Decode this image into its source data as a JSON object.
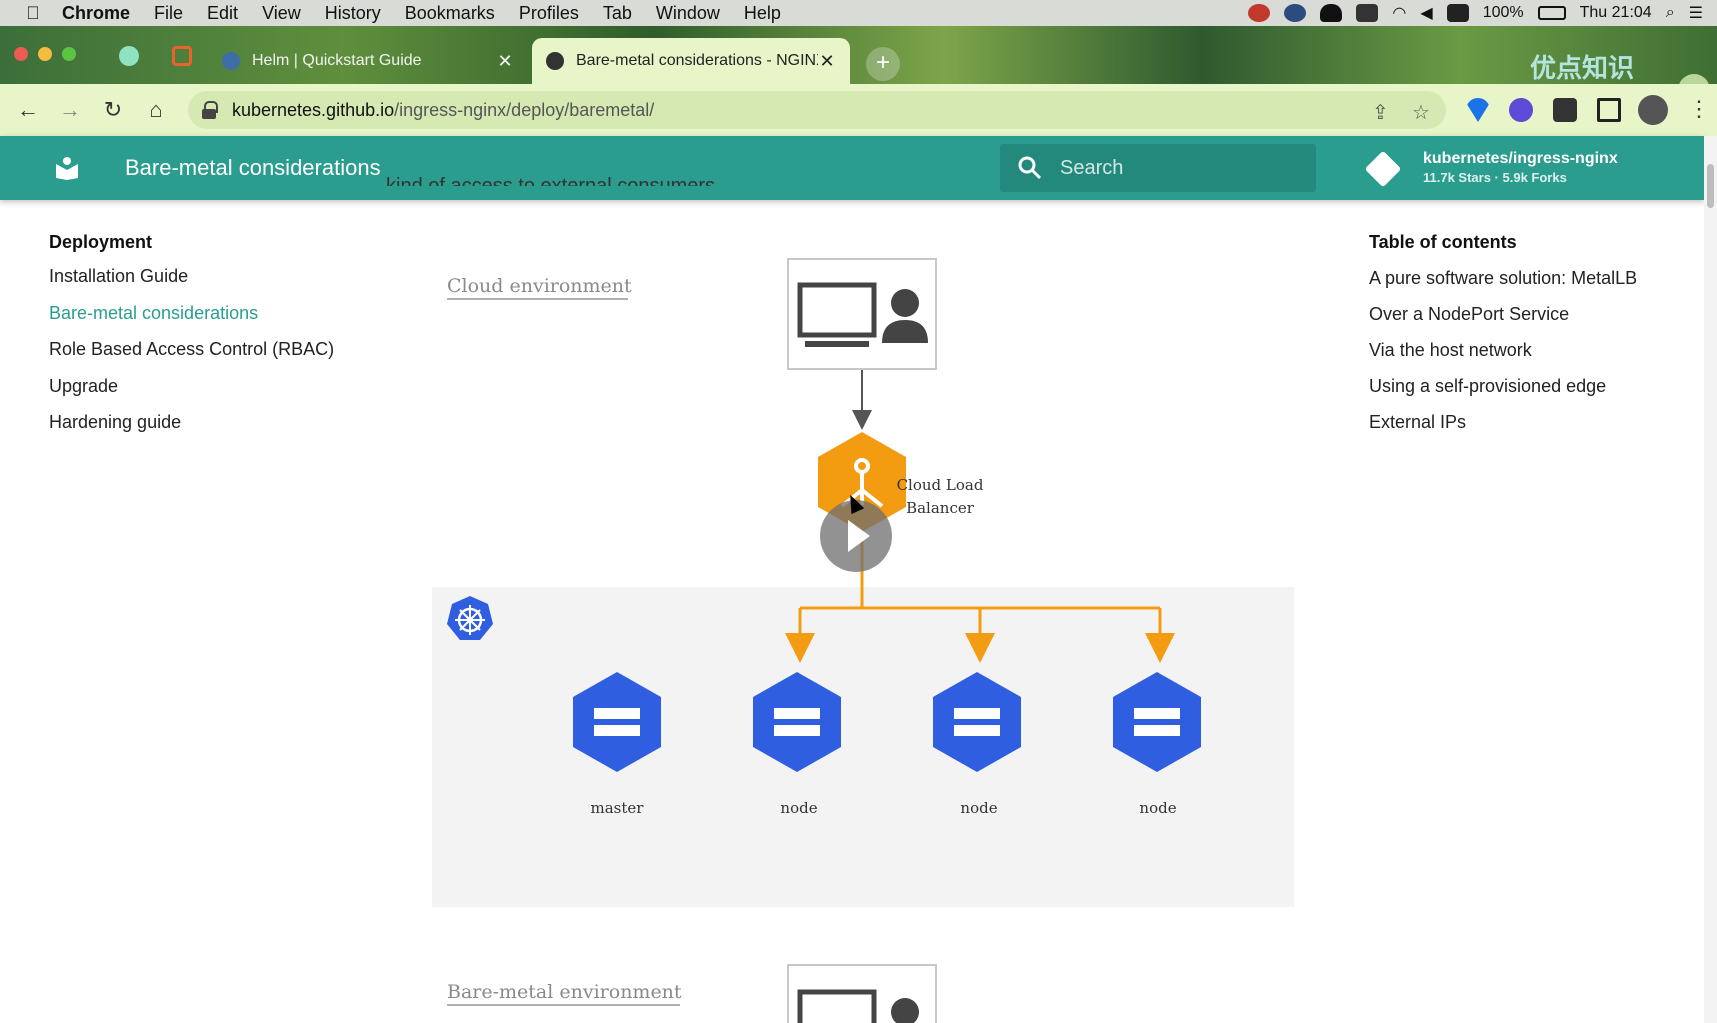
{
  "menubar": {
    "apple": "",
    "items": [
      "Chrome",
      "File",
      "Edit",
      "View",
      "History",
      "Bookmarks",
      "Profiles",
      "Tab",
      "Window",
      "Help"
    ],
    "battery": "100%",
    "clock": "Thu 21:04"
  },
  "tabs": {
    "inactive_title": "Helm | Quickstart Guide",
    "active_title": "Bare-metal considerations - NGINX Ingress Controller",
    "close": "✕",
    "new_tab": "+",
    "watermark": "优点知识"
  },
  "toolbar": {
    "url_host": "kubernetes.github.io",
    "url_path": "/ingress-nginx/deploy/baremetal/"
  },
  "site": {
    "title": "Bare-metal considerations",
    "search_placeholder": "Search",
    "repo_name": "kubernetes/ingress-nginx",
    "repo_facts": "11.7k Stars · 5.9k Forks",
    "cut_text": "kind of access to external consumers."
  },
  "leftnav": {
    "heading": "Deployment",
    "items": [
      "Installation Guide",
      "Bare-metal considerations",
      "Role Based Access Control (RBAC)",
      "Upgrade",
      "Hardening guide"
    ]
  },
  "toc": {
    "heading": "Table of contents",
    "items": [
      "A pure software solution: MetalLB",
      "Over a NodePort Service",
      "Via the host network",
      "Using a self-provisioned edge",
      "External IPs"
    ]
  },
  "diagram": {
    "cloud_label": "Cloud environment",
    "lb_label_1": "Cloud Load",
    "lb_label_2": "Balancer",
    "node_labels": [
      "master",
      "node",
      "node",
      "node"
    ],
    "baremetal_label": "Bare-metal environment",
    "colors": {
      "orange": "#f39c12",
      "blue": "#2f5fe0",
      "panel": "#f3f3f3"
    }
  }
}
